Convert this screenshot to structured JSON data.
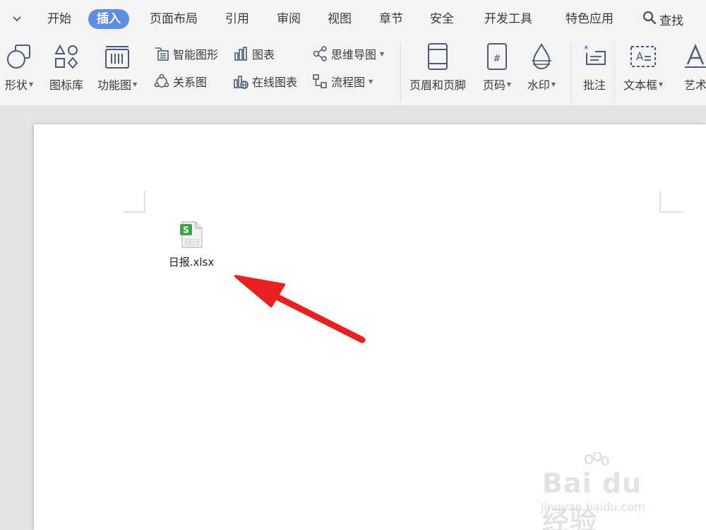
{
  "menubar": {
    "tabs": [
      {
        "label": "开始"
      },
      {
        "label": "插入"
      },
      {
        "label": "页面布局"
      },
      {
        "label": "引用"
      },
      {
        "label": "审阅"
      },
      {
        "label": "视图"
      },
      {
        "label": "章节"
      },
      {
        "label": "安全"
      },
      {
        "label": "开发工具"
      },
      {
        "label": "特色应用"
      }
    ],
    "active_tab": "插入",
    "search_label": "查找"
  },
  "ribbon": {
    "shapes": "形状",
    "icon_library": "图标库",
    "function_chart": "功能图",
    "smart_shape": "智能图形",
    "chart": "图表",
    "mind_map": "思维导图",
    "relation_chart": "关系图",
    "online_chart": "在线图表",
    "flowchart": "流程图",
    "header_footer": "页眉和页脚",
    "page_number": "页码",
    "watermark": "水印",
    "comment": "批注",
    "text_box": "文本框",
    "art_text": "艺术"
  },
  "document": {
    "attachment_name": "日报.xlsx",
    "attachment_badge": "S"
  },
  "watermark": {
    "brand": "Bai du 经验",
    "url": "jingyan.baidu.com"
  },
  "colors": {
    "active_tab": "#5b8fe6",
    "arrow": "#e8201f",
    "sheet_green": "#3aa648"
  }
}
